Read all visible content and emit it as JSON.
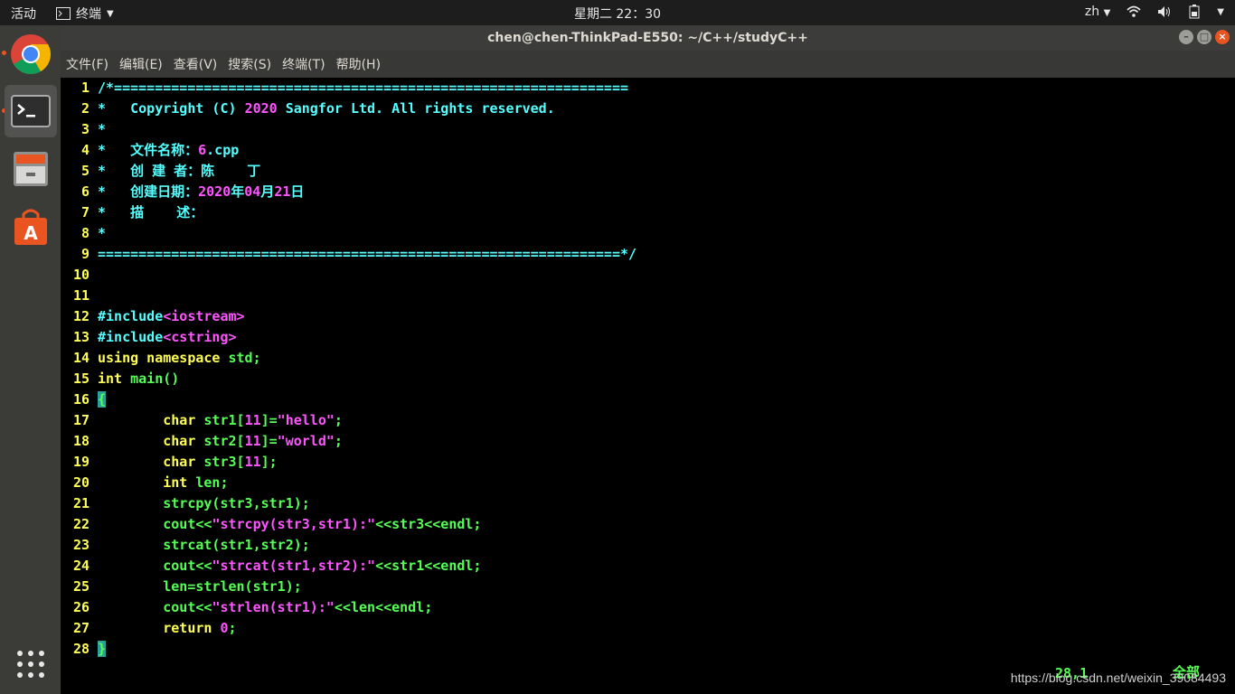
{
  "topbar": {
    "activities": "活动",
    "app_name": "终端",
    "clock": "星期二 22：30",
    "lang": "zh"
  },
  "dock": {
    "items": [
      "chrome-icon",
      "terminal-icon",
      "files-icon",
      "software-icon"
    ]
  },
  "window": {
    "title": "chen@chen-ThinkPad-E550: ~/C++/studyC++",
    "menu": [
      "文件(F)",
      "编辑(E)",
      "查看(V)",
      "搜索(S)",
      "终端(T)",
      "帮助(H)"
    ]
  },
  "editor": {
    "lines": [
      {
        "n": "1"
      },
      {
        "n": "2"
      },
      {
        "n": "3"
      },
      {
        "n": "4"
      },
      {
        "n": "5"
      },
      {
        "n": "6"
      },
      {
        "n": "7"
      },
      {
        "n": "8"
      },
      {
        "n": "9"
      },
      {
        "n": "10"
      },
      {
        "n": "11"
      },
      {
        "n": "12"
      },
      {
        "n": "13"
      },
      {
        "n": "14"
      },
      {
        "n": "15"
      },
      {
        "n": "16"
      },
      {
        "n": "17"
      },
      {
        "n": "18"
      },
      {
        "n": "19"
      },
      {
        "n": "20"
      },
      {
        "n": "21"
      },
      {
        "n": "22"
      },
      {
        "n": "23"
      },
      {
        "n": "24"
      },
      {
        "n": "25"
      },
      {
        "n": "26"
      },
      {
        "n": "27"
      },
      {
        "n": "28"
      }
    ],
    "status_pos": "28,1",
    "status_all": "全部"
  },
  "watermark": "https://blog.csdn.net/weixin_39084493",
  "colors": {
    "line_number": "#ffff55",
    "comment": "#55ffff",
    "constant": "#ff55ff",
    "identifier": "#55ff55",
    "keyword": "#ffff55"
  }
}
